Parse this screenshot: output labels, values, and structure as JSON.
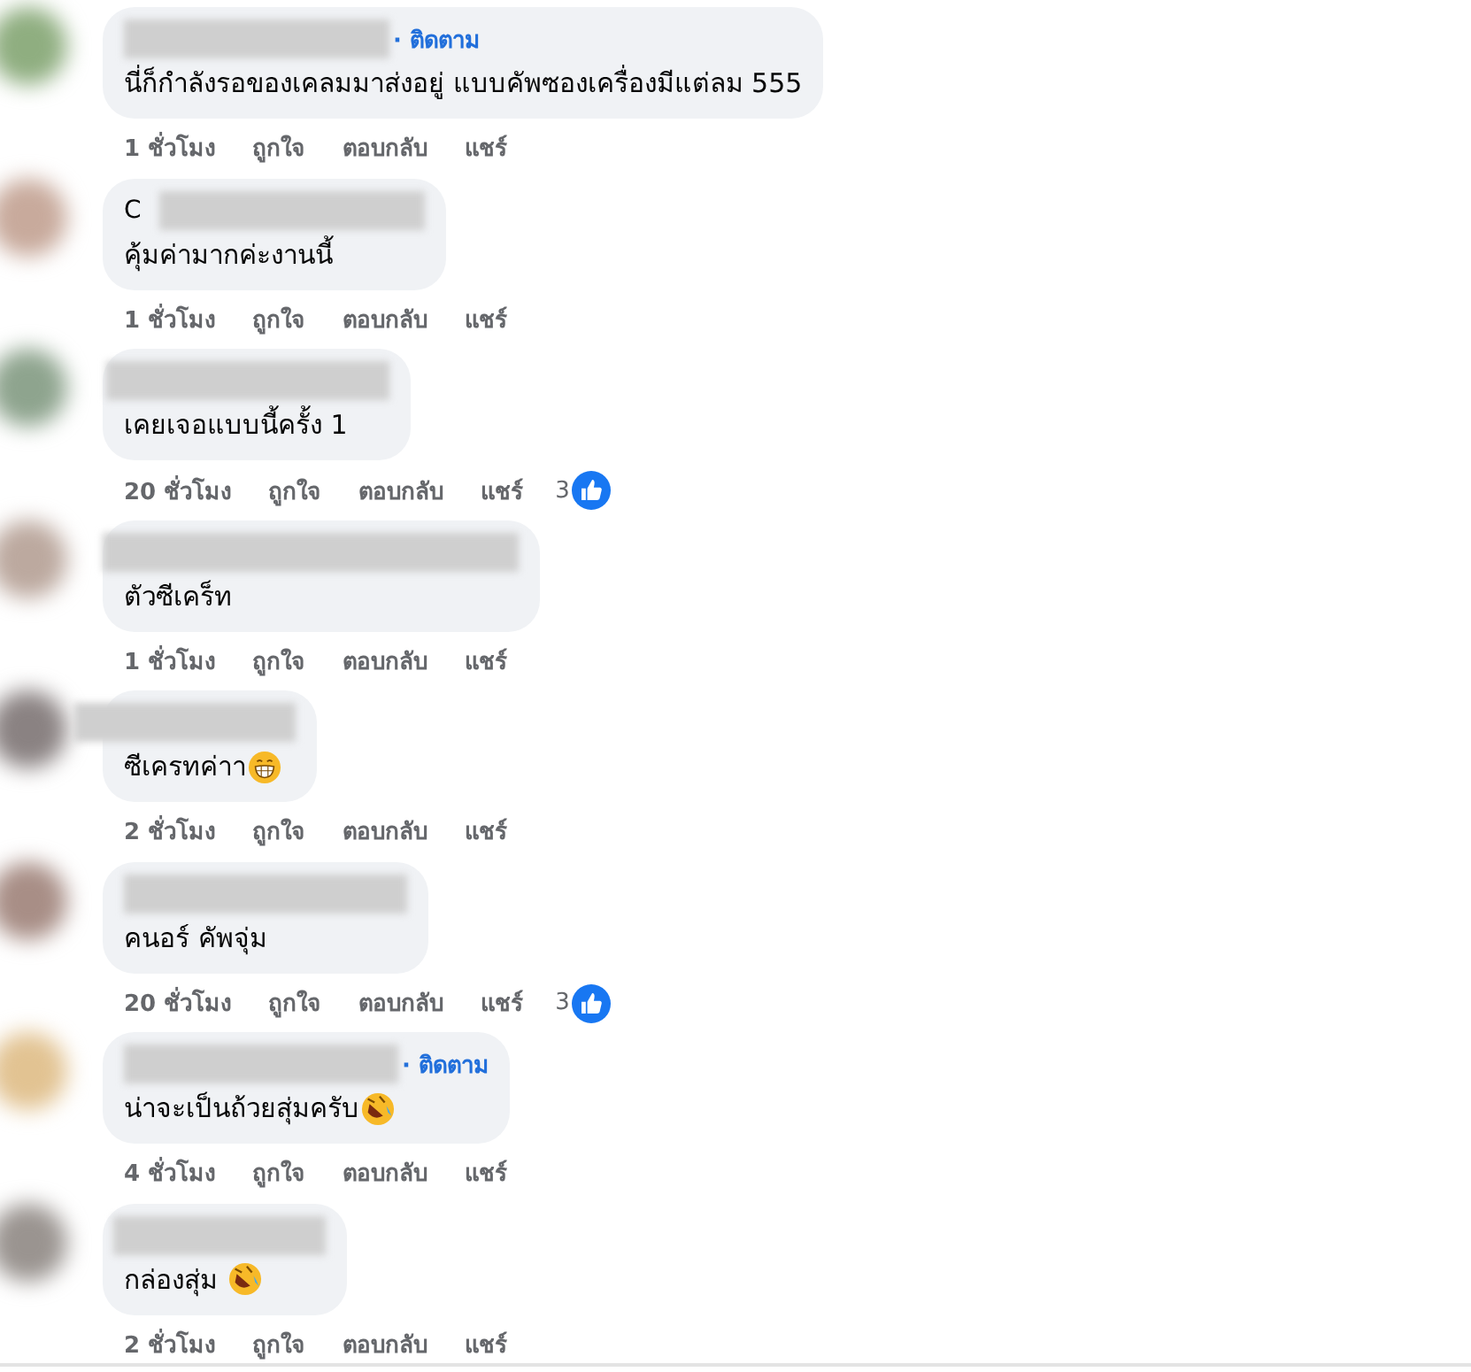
{
  "comments": [
    {
      "color": "#8fae80",
      "follow": "· ติดตาม",
      "text": "นี่ก็กำลังรอของเคลมมาส่งอยู่ แบบคัพซองเครื่องมีแต่ลม 555",
      "kind": "plain",
      "time": "1 ชั่วโมง",
      "actions": [
        "ถูกใจ",
        "ตอบกลับ",
        "แชร์"
      ]
    },
    {
      "color": "#c8aa9c",
      "name_shown": "C",
      "text": "คุ้มค่ามากค่ะงานนี้",
      "kind": "plain",
      "time": "1 ชั่วโมง",
      "actions": [
        "ถูกใจ",
        "ตอบกลับ",
        "แชร์"
      ]
    },
    {
      "color": "#8ea48e",
      "text": "เคยเจอแบบนี้ครั้ง 1",
      "kind": "plain",
      "time": "20 ชั่วโมง",
      "actions": [
        "ถูกใจ",
        "ตอบกลับ",
        "แชร์"
      ],
      "reactions": "3"
    },
    {
      "color": "#bca99f",
      "text": "ตัวซีเคร็ท",
      "kind": "plain",
      "time": "1 ชั่วโมง",
      "actions": [
        "ถูกใจ",
        "ตอบกลับ",
        "แชร์"
      ]
    },
    {
      "color": "#8a8282",
      "text": "ซีเครทค่าา",
      "kind": "grin",
      "time": "2 ชั่วโมง",
      "actions": [
        "ถูกใจ",
        "ตอบกลับ",
        "แชร์"
      ]
    },
    {
      "color": "#a88e86",
      "text": "คนอร์ คัพจุ่ม",
      "kind": "plain",
      "time": "20 ชั่วโมง",
      "actions": [
        "ถูกใจ",
        "ตอบกลับ",
        "แชร์"
      ],
      "reactions": "3"
    },
    {
      "color": "#e2c392",
      "follow": "· ติดตาม",
      "text": "น่าจะเป็นถ้วยสุ่มครับ",
      "kind": "rofl",
      "time": "4 ชั่วโมง",
      "actions": [
        "ถูกใจ",
        "ตอบกลับ",
        "แชร์"
      ]
    },
    {
      "color": "#9a9490",
      "text": "กล่องสุ่ม ",
      "kind": "rofl",
      "time": "2 ชั่วโมง",
      "actions": [
        "ถูกใจ",
        "ตอบกลับ",
        "แชร์"
      ]
    }
  ]
}
